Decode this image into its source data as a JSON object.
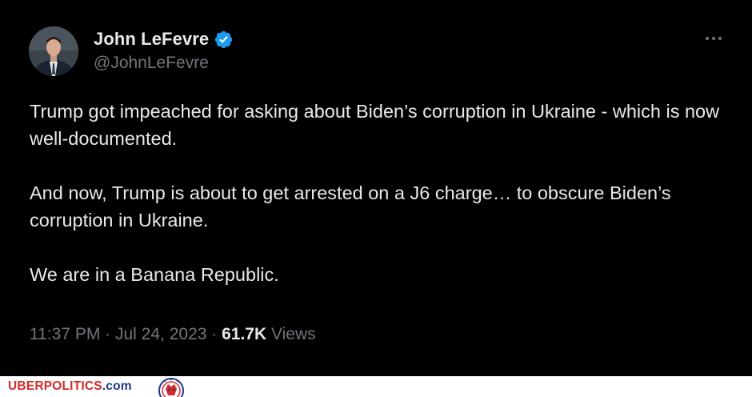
{
  "tweet": {
    "author": {
      "display_name": "John LeFevre",
      "handle": "@JohnLeFevre",
      "verified": true
    },
    "body": [
      "Trump got impeached for asking about Biden’s corruption in Ukraine - which is now well-documented.",
      "And now, Trump is about to get arrested on a J6 charge… to obscure Biden’s corruption in Ukraine.",
      "We are in a Banana Republic."
    ],
    "time": "11:37 PM",
    "date": "Jul 24, 2023",
    "views_count": "61.7K",
    "views_label": "Views"
  },
  "watermark": {
    "brand_part1": "UBERPOLITICS",
    "brand_part2": ".com"
  },
  "colors": {
    "background": "#000000",
    "text_primary": "#e7e9ea",
    "text_secondary": "#71767b",
    "verified_badge": "#1d9bf0",
    "brand_red": "#d52b2b",
    "brand_blue": "#1d3a8a"
  },
  "icons": {
    "verified": "verified-badge-icon",
    "more": "more-options-icon"
  }
}
